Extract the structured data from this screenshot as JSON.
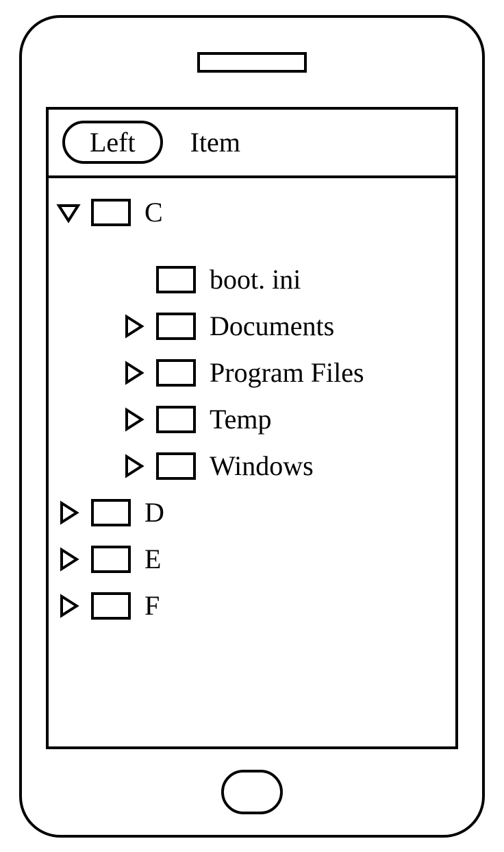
{
  "header": {
    "left_button_label": "Left",
    "title": "Item"
  },
  "tree": {
    "root_c": {
      "label": "C",
      "expanded": true
    },
    "boot_ini": {
      "label": "boot. ini",
      "expanded": null
    },
    "documents": {
      "label": "Documents",
      "expanded": false
    },
    "program_files": {
      "label": "Program Files",
      "expanded": false
    },
    "temp": {
      "label": "Temp",
      "expanded": false
    },
    "windows": {
      "label": "Windows",
      "expanded": false
    },
    "root_d": {
      "label": "D",
      "expanded": false
    },
    "root_e": {
      "label": "E",
      "expanded": false
    },
    "root_f": {
      "label": "F",
      "expanded": false
    }
  }
}
